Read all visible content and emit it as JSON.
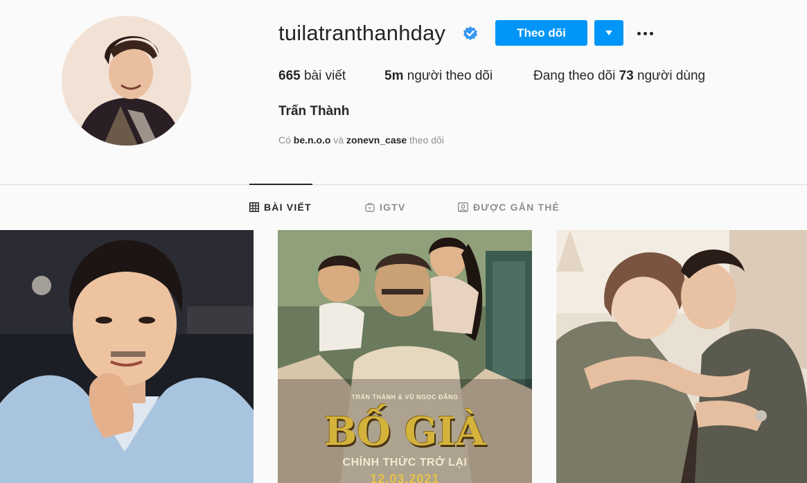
{
  "profile": {
    "username": "tuilatranthanhday",
    "verified": true,
    "full_name": "Trấn Thành",
    "follow_label": "Theo dõi",
    "stats": {
      "posts_count": "665",
      "posts_label": "bài viết",
      "followers_count": "5m",
      "followers_label": "người theo dõi",
      "following_prefix": "Đang theo dõi",
      "following_count": "73",
      "following_label": "người dùng"
    },
    "followed_by": {
      "prefix": "Có",
      "account1": "be.n.o.o",
      "conjunction": "và",
      "account2": "zonevn_case",
      "suffix": "theo dõi"
    }
  },
  "tabs": [
    {
      "label": "BÀI VIẾT",
      "icon": "grid-icon",
      "active": true
    },
    {
      "label": "IGTV",
      "icon": "igtv-icon",
      "active": false
    },
    {
      "label": "ĐƯỢC GẮN THẺ",
      "icon": "tagged-icon",
      "active": false
    }
  ],
  "posts": [
    {
      "type": "photo",
      "description": "selfie"
    },
    {
      "type": "movie-poster",
      "credits": "TRẤN THÀNH & VŨ NGỌC ĐÃNG",
      "title": "BỐ GIÀ",
      "subtitle": "CHÍNH THỨC TRỞ LẠI",
      "date": "12.03.2021"
    },
    {
      "type": "photo",
      "description": "couple"
    }
  ],
  "colors": {
    "accent": "#0095f6",
    "background": "#fafafa",
    "text": "#262626",
    "muted": "#8e8e8e",
    "divider": "#dbdbdb",
    "verified_badge": "#3897f0"
  }
}
